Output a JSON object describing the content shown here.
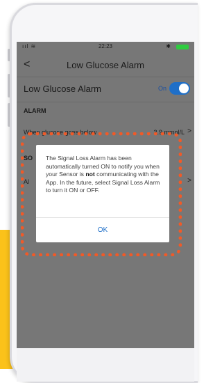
{
  "status_bar": {
    "signal": "ııl ≋",
    "time": "22:23",
    "bluetooth": "✱"
  },
  "nav": {
    "back_icon": "chevron-left-icon",
    "title": "Low Glucose Alarm"
  },
  "alarm_row": {
    "label": "Low Glucose Alarm",
    "state": "On",
    "toggle_on": true
  },
  "section": {
    "header": "ALARM"
  },
  "threshold_row": {
    "text": "When glucose goes below",
    "value": "3.9 mmol/L"
  },
  "partial": {
    "sound_header": "SO",
    "alarm_label": "Al"
  },
  "dialog": {
    "message_before": "The Signal Loss Alarm has been automatically turned ON to notify you when your Sensor is ",
    "message_bold": "not",
    "message_after": " communicating with the App. In the future, select Signal Loss Alarm to turn it ON or OFF.",
    "ok_label": "OK"
  },
  "colors": {
    "accent": "#1f6fc8",
    "highlight_dots": "#f05a28",
    "yellow_panel": "#fbc21a",
    "battery": "#2ecc40"
  }
}
